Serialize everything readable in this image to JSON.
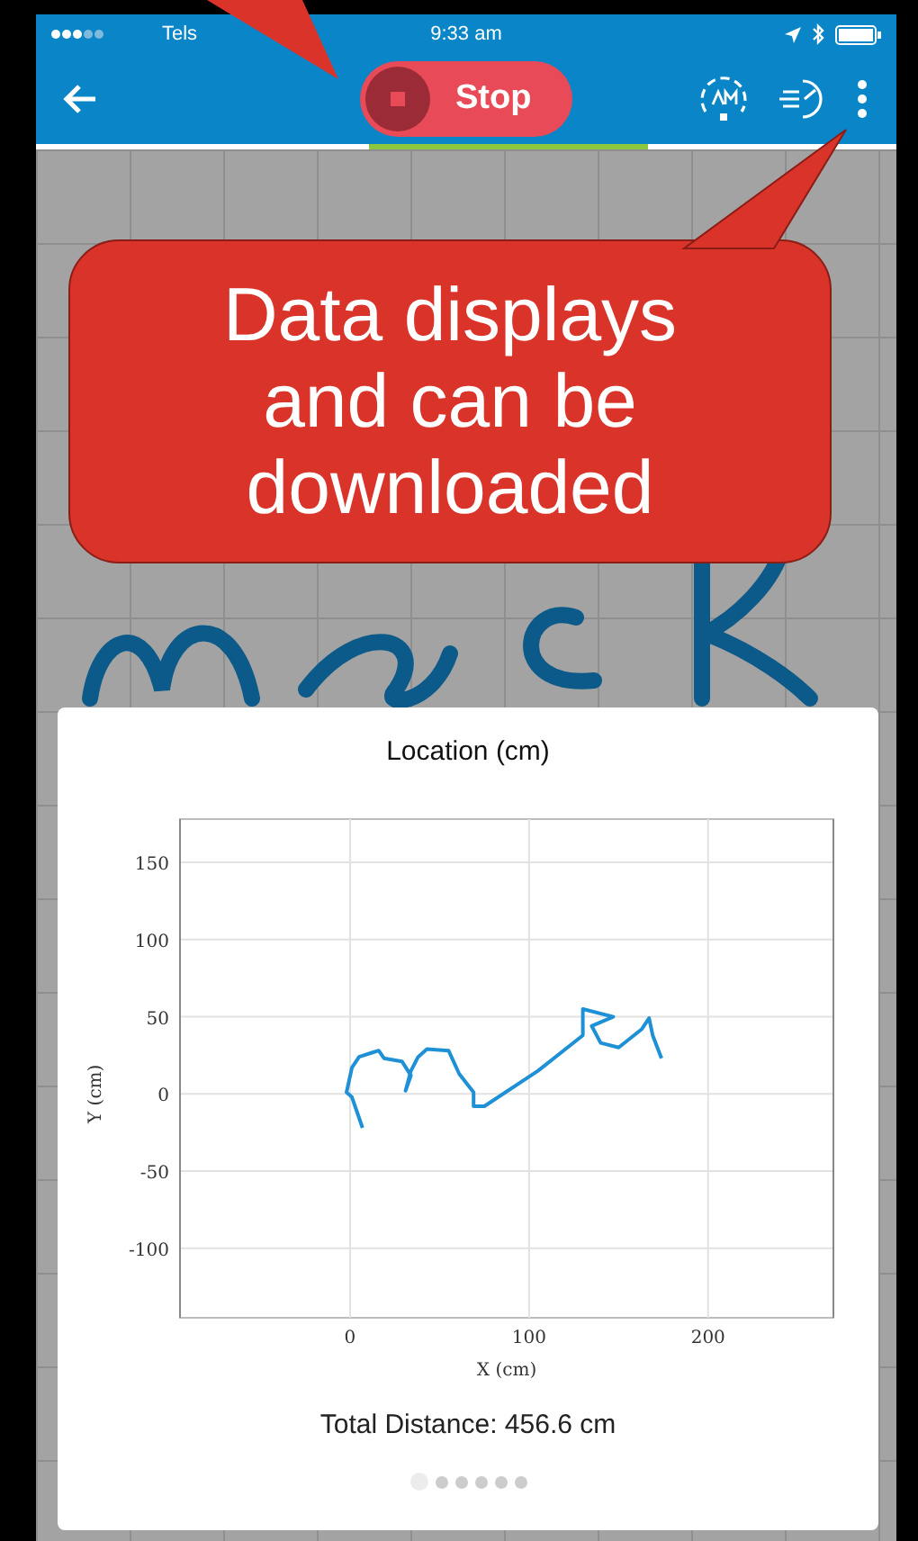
{
  "status_bar": {
    "carrier": "Tels",
    "time": "9:33 am"
  },
  "toolbar": {
    "stop_button": {
      "label": "Stop"
    }
  },
  "chart_card": {
    "chart_data": {
      "type": "line",
      "title": "Location (cm)",
      "xlabel": "X (cm)",
      "ylabel": "Y (cm)",
      "x": [
        7,
        1,
        -2,
        1,
        5,
        13,
        16,
        19,
        29,
        34,
        31,
        34,
        38,
        43,
        55,
        61,
        69,
        69,
        75,
        105,
        130,
        130,
        147,
        135,
        140,
        150,
        163,
        167,
        169,
        174
      ],
      "series": [
        {
          "color": "#1e90d6",
          "values": [
            -22,
            -2,
            1,
            17,
            24,
            27,
            28,
            23,
            21,
            12,
            2,
            15,
            24,
            29,
            28,
            13,
            1,
            -8,
            -8,
            15,
            38,
            55,
            50,
            44,
            33,
            30,
            42,
            49,
            38,
            23
          ]
        }
      ],
      "grid": true,
      "xlim": [
        -95,
        270
      ],
      "ylim": [
        -145,
        178
      ],
      "xticks": [
        0,
        100,
        200
      ],
      "yticks": [
        -100,
        -50,
        0,
        50,
        100,
        150
      ]
    },
    "total_distance": "Total Distance: 456.6 cm",
    "page_dots": [
      {
        "selected": true
      },
      {
        "selected": false
      },
      {
        "selected": false
      },
      {
        "selected": false
      },
      {
        "selected": false
      },
      {
        "selected": false
      }
    ]
  },
  "callout": {
    "text": "Data displays and can be downloaded"
  }
}
